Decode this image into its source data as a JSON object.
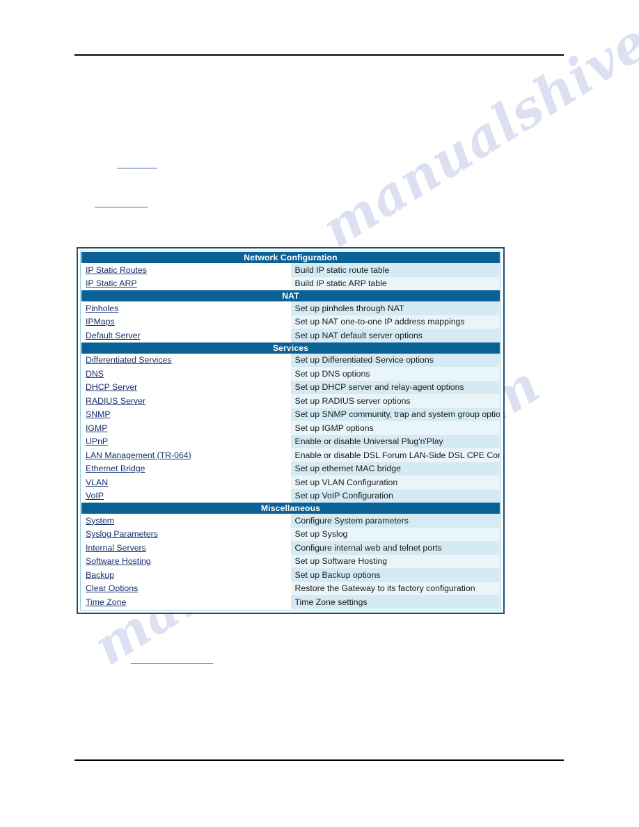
{
  "page": {
    "blank_links": [
      "",
      "",
      ""
    ],
    "watermark_text": "manualshive.com"
  },
  "config_table": {
    "sections": [
      {
        "title": "Network Configuration",
        "items": [
          {
            "link": "IP Static Routes",
            "description": "Build IP static route table"
          },
          {
            "link": "IP Static ARP",
            "description": "Build IP static ARP table"
          }
        ]
      },
      {
        "title": "NAT",
        "items": [
          {
            "link": "Pinholes",
            "description": "Set up pinholes through NAT"
          },
          {
            "link": "IPMaps",
            "description": "Set up NAT one-to-one IP address mappings"
          },
          {
            "link": "Default Server",
            "description": "Set up NAT default server options"
          }
        ]
      },
      {
        "title": "Services",
        "items": [
          {
            "link": "Differentiated Services",
            "description": "Set up Differentiated Service options"
          },
          {
            "link": "DNS",
            "description": "Set up DNS options"
          },
          {
            "link": "DHCP Server",
            "description": "Set up DHCP server and relay-agent options"
          },
          {
            "link": "RADIUS Server",
            "description": "Set up RADIUS server options"
          },
          {
            "link": "SNMP",
            "description": "Set up SNMP community, trap and system group options"
          },
          {
            "link": "IGMP",
            "description": "Set up IGMP options"
          },
          {
            "link": "UPnP",
            "description": "Enable or disable Universal Plug'n'Play"
          },
          {
            "link": "LAN Management (TR-064)",
            "description": "Enable or disable DSL Forum LAN-Side DSL CPE Configuration services"
          },
          {
            "link": "Ethernet Bridge",
            "description": "Set up ethernet MAC bridge"
          },
          {
            "link": "VLAN",
            "description": "Set up VLAN Configuration"
          },
          {
            "link": "VoIP",
            "description": "Set up VoIP Configuration"
          }
        ]
      },
      {
        "title": "Miscellaneous",
        "items": [
          {
            "link": "System",
            "description": "Configure System parameters"
          },
          {
            "link": "Syslog Parameters",
            "description": "Set up Syslog"
          },
          {
            "link": "Internal Servers",
            "description": "Configure internal web and telnet ports"
          },
          {
            "link": "Software Hosting",
            "description": "Set up Software Hosting"
          },
          {
            "link": "Backup",
            "description": "Set up Backup options"
          },
          {
            "link": "Clear Options",
            "description": "Restore the Gateway to its factory configuration"
          },
          {
            "link": "Time Zone",
            "description": "Time Zone settings"
          }
        ]
      }
    ]
  },
  "colors": {
    "section_header_bg": "#0a6196",
    "row_shade": "#d6eaf4",
    "row_plain": "#eaf5fa",
    "link_color": "#16306b",
    "table_border": "#1d4f70"
  }
}
